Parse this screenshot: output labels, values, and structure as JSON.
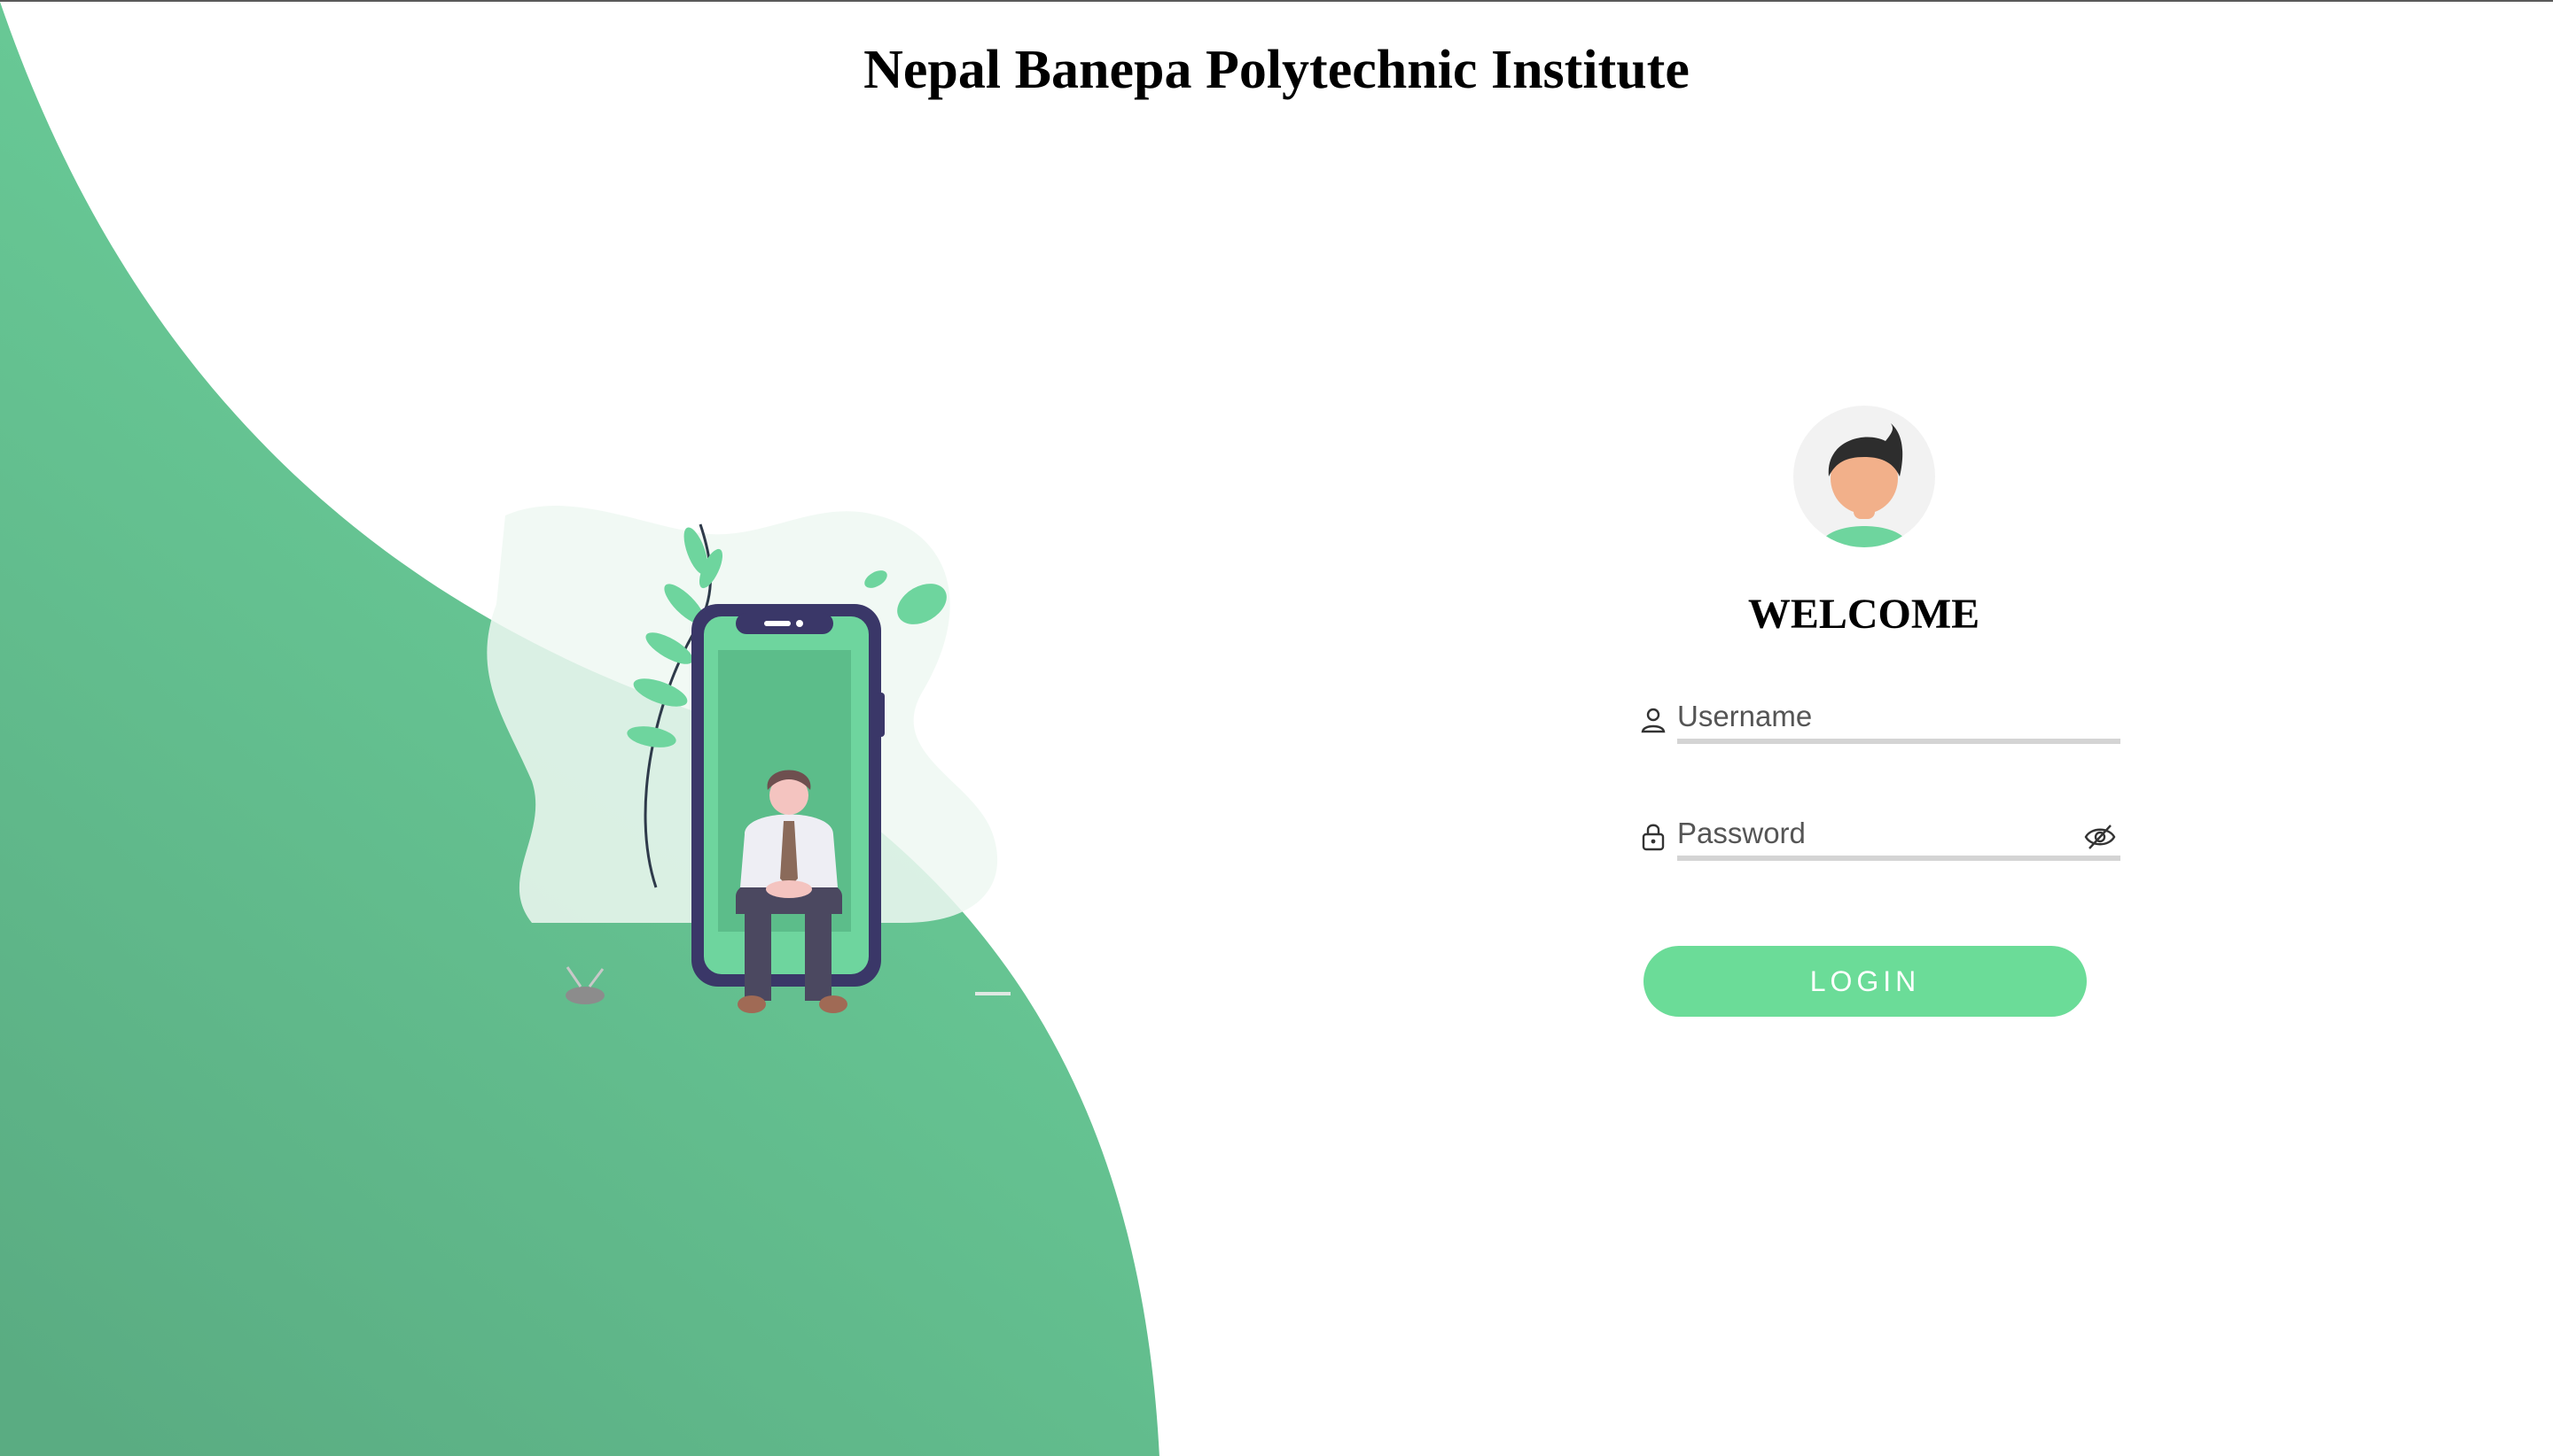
{
  "page": {
    "title": "Nepal Banepa Polytechnic Institute"
  },
  "colors": {
    "accent": "#6bdc98",
    "wave_top": "#6ed59e",
    "wave_bottom": "#5aac82"
  },
  "login": {
    "heading": "WELCOME",
    "username": {
      "placeholder": "Username",
      "value": "",
      "icon": "user-icon"
    },
    "password": {
      "placeholder": "Password",
      "value": "",
      "icon": "lock-icon",
      "toggle_icon": "eye-off-icon"
    },
    "button_label": "LOGIN"
  }
}
